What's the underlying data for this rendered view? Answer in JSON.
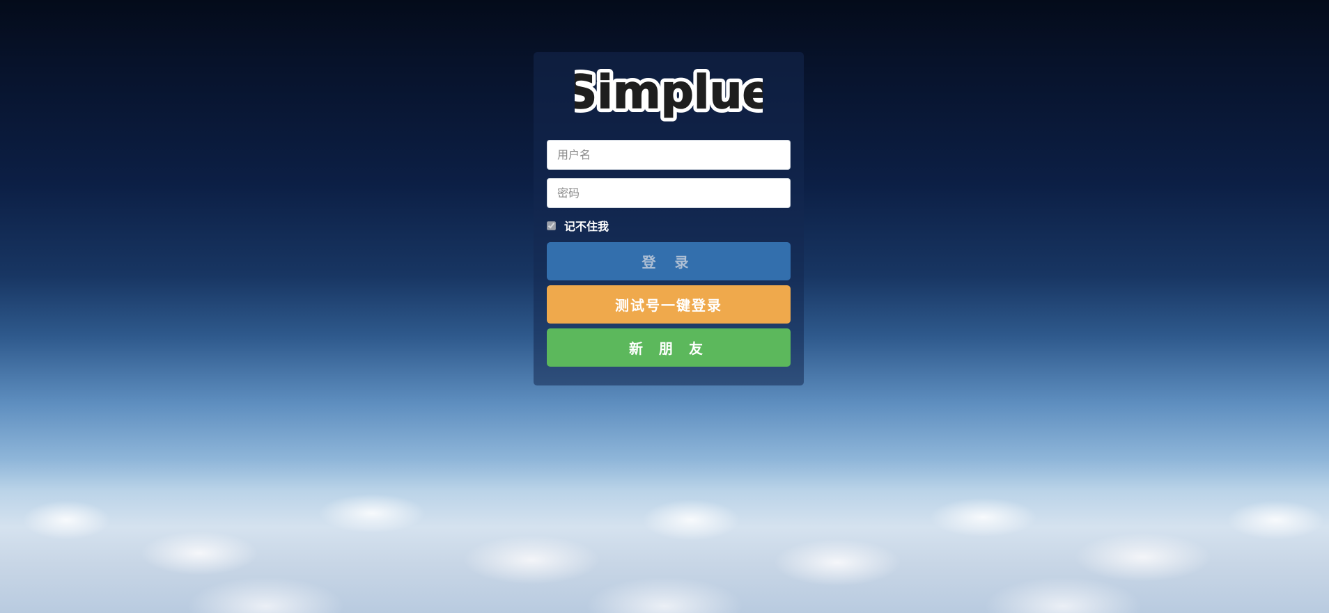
{
  "logo": {
    "text": "Simplue"
  },
  "form": {
    "username_placeholder": "用户名",
    "password_placeholder": "密码",
    "remember_label": "记不住我",
    "remember_checked": true
  },
  "buttons": {
    "login_label": "登 录",
    "test_login_label": "测试号一键登录",
    "new_friend_label": "新 朋 友"
  },
  "colors": {
    "login_button": "#336fad",
    "test_login_button": "#efa94c",
    "new_friend_button": "#5cb85c"
  }
}
